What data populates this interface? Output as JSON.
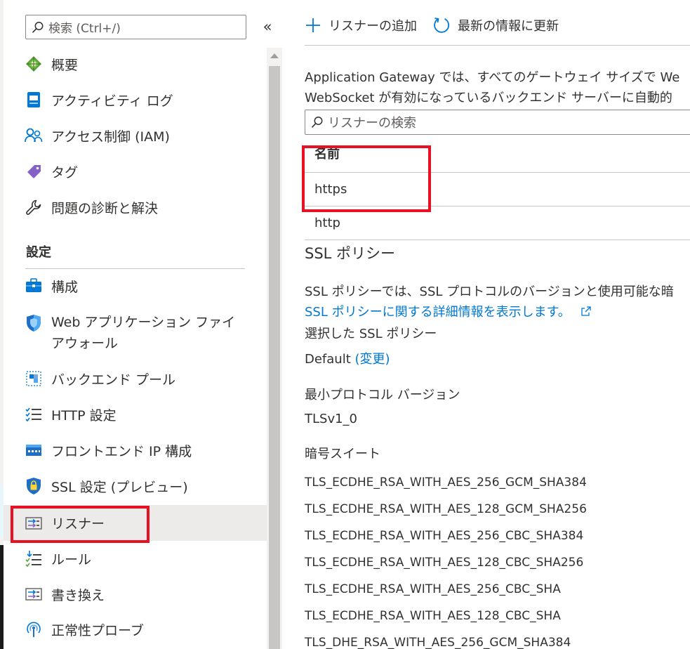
{
  "nav": {
    "search_placeholder": "検索 (Ctrl+/)",
    "collapse_glyph": "«",
    "items_top": [
      {
        "label": "概要",
        "icon": "overview-icon"
      },
      {
        "label": "アクティビティ ログ",
        "icon": "activity-log-icon"
      },
      {
        "label": "アクセス制御 (IAM)",
        "icon": "iam-icon"
      },
      {
        "label": "タグ",
        "icon": "tag-icon"
      },
      {
        "label": "問題の診断と解決",
        "icon": "wrench-icon"
      }
    ],
    "settings_heading": "設定",
    "items_settings": [
      {
        "label": "構成",
        "icon": "configuration-icon"
      },
      {
        "label": "Web アプリケーション ファイアウォール",
        "icon": "waf-shield-icon"
      },
      {
        "label": "バックエンド プール",
        "icon": "backend-pool-icon"
      },
      {
        "label": "HTTP 設定",
        "icon": "http-settings-icon"
      },
      {
        "label": "フロントエンド IP 構成",
        "icon": "frontend-ip-icon"
      },
      {
        "label": "SSL 設定 (プレビュー)",
        "icon": "ssl-shield-icon"
      },
      {
        "label": "リスナー",
        "icon": "listener-icon",
        "selected": true
      },
      {
        "label": "ルール",
        "icon": "rules-icon"
      },
      {
        "label": "書き換え",
        "icon": "rewrite-icon"
      },
      {
        "label": "正常性プローブ",
        "icon": "health-probe-icon"
      }
    ]
  },
  "toolbar": {
    "add_label": "リスナーの追加",
    "refresh_label": "最新の情報に更新"
  },
  "description": {
    "line1": "Application Gateway では、すべてのゲートウェイ サイズで We",
    "line2": "WebSocket が有効になっているバックエンド サーバーに自動的"
  },
  "listener_search_placeholder": "リスナーの検索",
  "listeners_table": {
    "header_name": "名前",
    "rows": [
      "https",
      "http"
    ]
  },
  "ssl_policy": {
    "heading": "SSL ポリシー",
    "desc": "SSL ポリシーでは、SSL プロトコルのバージョンと使用可能な暗",
    "link": "SSL ポリシーに関する詳細情報を表示します。",
    "selected_label": "選択した SSL ポリシー",
    "selected_value": "Default",
    "change_link": "(変更)",
    "min_protocol_label": "最小プロトコル バージョン",
    "min_protocol_value": "TLSv1_0",
    "cipher_suites_label": "暗号スイート",
    "cipher_suites": [
      "TLS_ECDHE_RSA_WITH_AES_256_GCM_SHA384",
      "TLS_ECDHE_RSA_WITH_AES_128_GCM_SHA256",
      "TLS_ECDHE_RSA_WITH_AES_256_CBC_SHA384",
      "TLS_ECDHE_RSA_WITH_AES_128_CBC_SHA256",
      "TLS_ECDHE_RSA_WITH_AES_256_CBC_SHA",
      "TLS_ECDHE_RSA_WITH_AES_128_CBC_SHA",
      "TLS_DHE_RSA_WITH_AES_256_GCM_SHA384"
    ]
  },
  "colors": {
    "accent": "#0078d4",
    "highlight_box": "#e81123",
    "selected_bg": "#edebe9"
  }
}
